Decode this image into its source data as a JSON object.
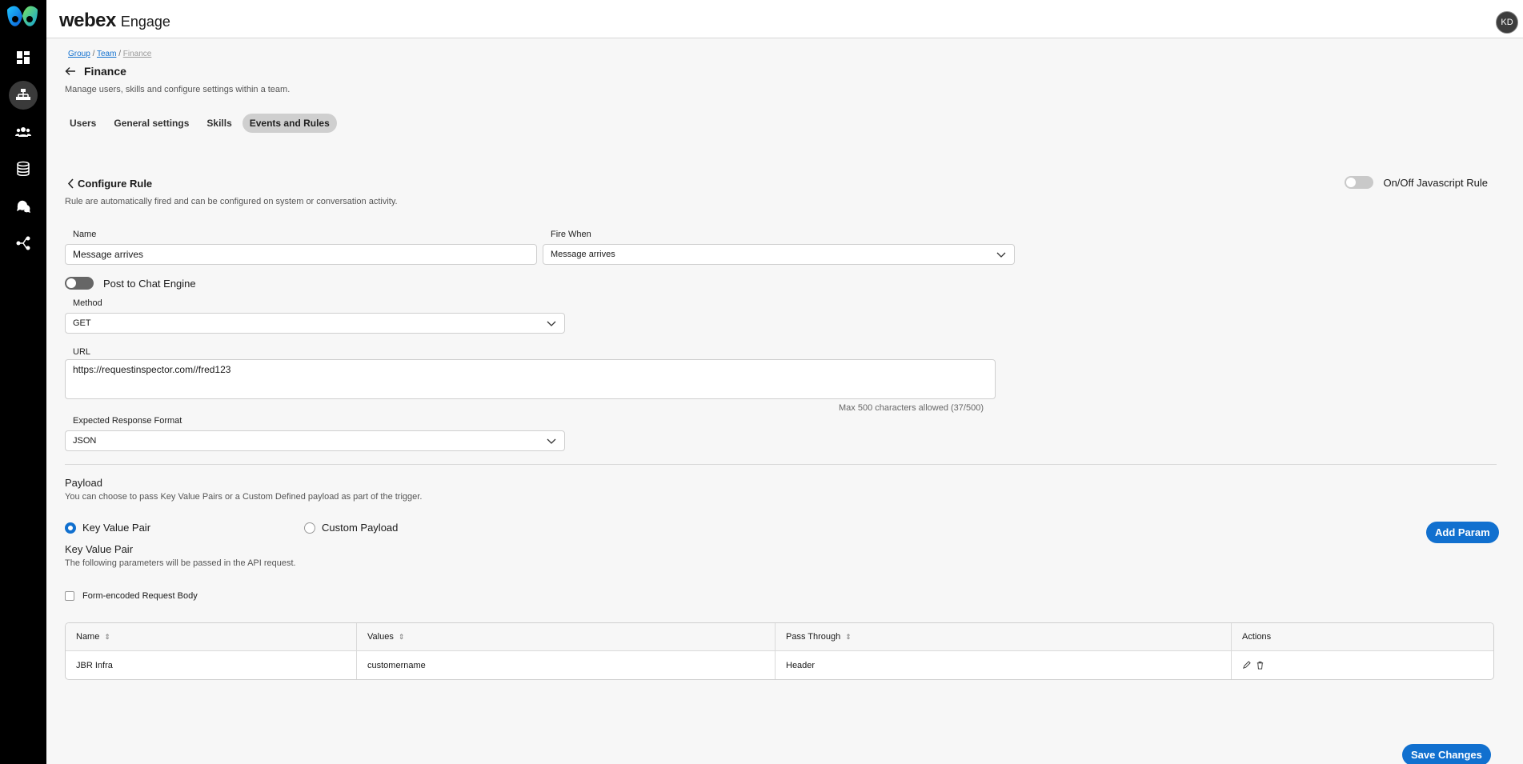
{
  "app": {
    "brand": "webex",
    "product": "Engage",
    "avatar_initials": "KD"
  },
  "sidebar": {
    "items": [
      {
        "name": "dashboard",
        "icon": "dashboard-icon",
        "active": false
      },
      {
        "name": "org-hierarchy",
        "icon": "org-chart-icon",
        "active": true
      },
      {
        "name": "people",
        "icon": "people-icon",
        "active": false
      },
      {
        "name": "database",
        "icon": "database-icon",
        "active": false
      },
      {
        "name": "chat",
        "icon": "chat-icon",
        "active": false
      },
      {
        "name": "flow",
        "icon": "flow-icon",
        "active": false
      }
    ]
  },
  "breadcrumb": {
    "group": "Group",
    "team": "Team",
    "current": "Finance",
    "sep": "/"
  },
  "page": {
    "title": "Finance",
    "subtitle": "Manage users, skills and configure settings within a team."
  },
  "tabs": [
    {
      "label": "Users",
      "selected": false
    },
    {
      "label": "General settings",
      "selected": false
    },
    {
      "label": "Skills",
      "selected": false
    },
    {
      "label": "Events and Rules",
      "selected": true
    }
  ],
  "configure": {
    "title": "Configure Rule",
    "description": "Rule are automatically fired and can be configured on system or conversation activity.",
    "js_toggle_label": "On/Off Javascript Rule"
  },
  "form": {
    "name_label": "Name",
    "name_value": "Message arrives",
    "fire_when_label": "Fire When",
    "fire_when_value": "Message arrives",
    "post_to_chat_label": "Post to Chat Engine",
    "method_label": "Method",
    "method_value": "GET",
    "url_label": "URL",
    "url_value": "https://requestinspector.com//fred123",
    "url_counter": "Max 500 characters allowed (37/500)",
    "response_label": "Expected Response Format",
    "response_value": "JSON"
  },
  "payload": {
    "title": "Payload",
    "description": "You can choose to pass Key Value Pairs or a Custom Defined payload as part of the trigger.",
    "option_kv": "Key Value Pair",
    "option_custom": "Custom Payload",
    "selected": "kv",
    "add_param": "Add Param",
    "kv_title": "Key Value Pair",
    "kv_desc": "The following parameters will be passed in the API request.",
    "form_encoded_label": "Form-encoded Request Body"
  },
  "table": {
    "headers": {
      "name": "Name",
      "values": "Values",
      "pass_through": "Pass Through",
      "actions": "Actions"
    },
    "rows": [
      {
        "name": "JBR Infra",
        "values": "customername",
        "pass_through": "Header"
      }
    ]
  },
  "footer": {
    "save": "Save Changes"
  },
  "colors": {
    "accent": "#1170cf",
    "rail": "#000000"
  }
}
